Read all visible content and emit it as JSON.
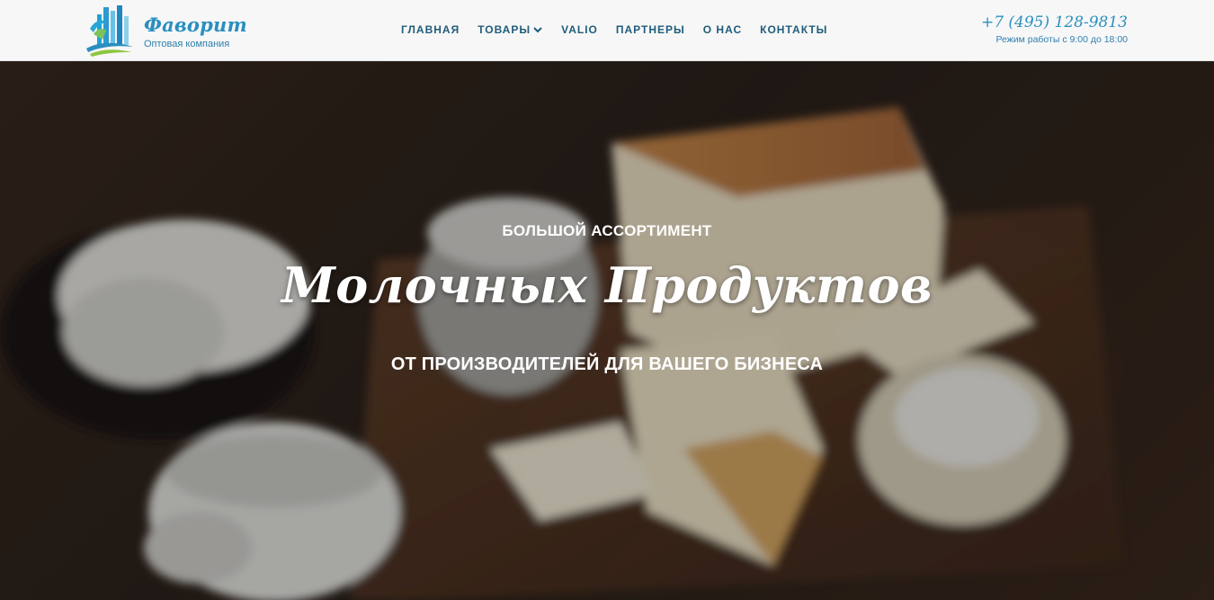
{
  "header": {
    "logo": {
      "name": "Фаворит",
      "tagline": "Оптовая компания"
    },
    "nav": [
      {
        "label": "ГЛАВНАЯ",
        "icon": null
      },
      {
        "label": "ТОВАРЫ",
        "icon": "chevron-down-icon"
      },
      {
        "label": "VALIO",
        "icon": null
      },
      {
        "label": "ПАРТНЕРЫ",
        "icon": null
      },
      {
        "label": "О НАС",
        "icon": null
      },
      {
        "label": "КОНТАКТЫ",
        "icon": null
      }
    ],
    "contact": {
      "phone": "+7 (495) 128-9813",
      "hours": "Режим работы с 9:00 до 18:00"
    }
  },
  "hero": {
    "kicker": "БОЛЬШОЙ АССОРТИМЕНТ",
    "title": "Молочных Продуктов",
    "subtitle": "ОТ ПРОИЗВОДИТЕЛЕЙ ДЛЯ ВАШЕГО БИЗНЕСА"
  },
  "colors": {
    "brand": "#2a8fbf",
    "nav_text": "#1f5c7a",
    "header_bg": "#f7f7f7",
    "hero_text": "#ffffff"
  }
}
